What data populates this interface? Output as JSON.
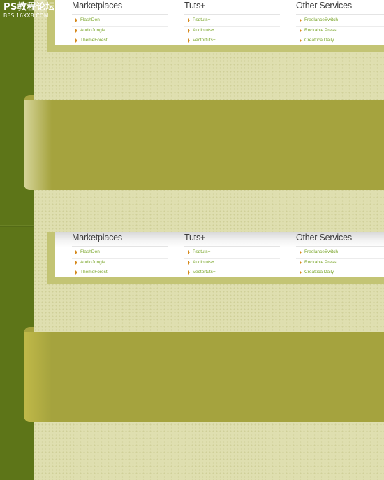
{
  "watermark": {
    "line1": "PS教程论坛",
    "line2": "BBS.16XX8.COM"
  },
  "sections": [
    {
      "columns": [
        {
          "title": "Marketplaces",
          "links": [
            "FlashDen",
            "AudioJungle",
            "ThemeForest"
          ]
        },
        {
          "title": "Tuts+",
          "links": [
            "Psdtuts+",
            "Audiotuts+",
            "Vectortuts+"
          ]
        },
        {
          "title": "Other Services",
          "links": [
            "FreelanceSwitch",
            "Rockable Press",
            "Creattica Daily"
          ]
        }
      ]
    },
    {
      "columns": [
        {
          "title": "Marketplaces",
          "links": [
            "FlashDen",
            "AudioJungle",
            "ThemeForest"
          ]
        },
        {
          "title": "Tuts+",
          "links": [
            "Psdtuts+",
            "Audiotuts+",
            "Vectortuts+"
          ]
        },
        {
          "title": "Other Services",
          "links": [
            "FreelanceSwitch",
            "Rockable Press",
            "Creattica Daily"
          ]
        }
      ]
    }
  ],
  "colors": {
    "sidebar": "#5d7518",
    "background": "#dfdfb0",
    "frame": "#c3c474",
    "banner": "#a5a33e",
    "link": "#7aa62b",
    "arrow": "#d58a1d"
  }
}
